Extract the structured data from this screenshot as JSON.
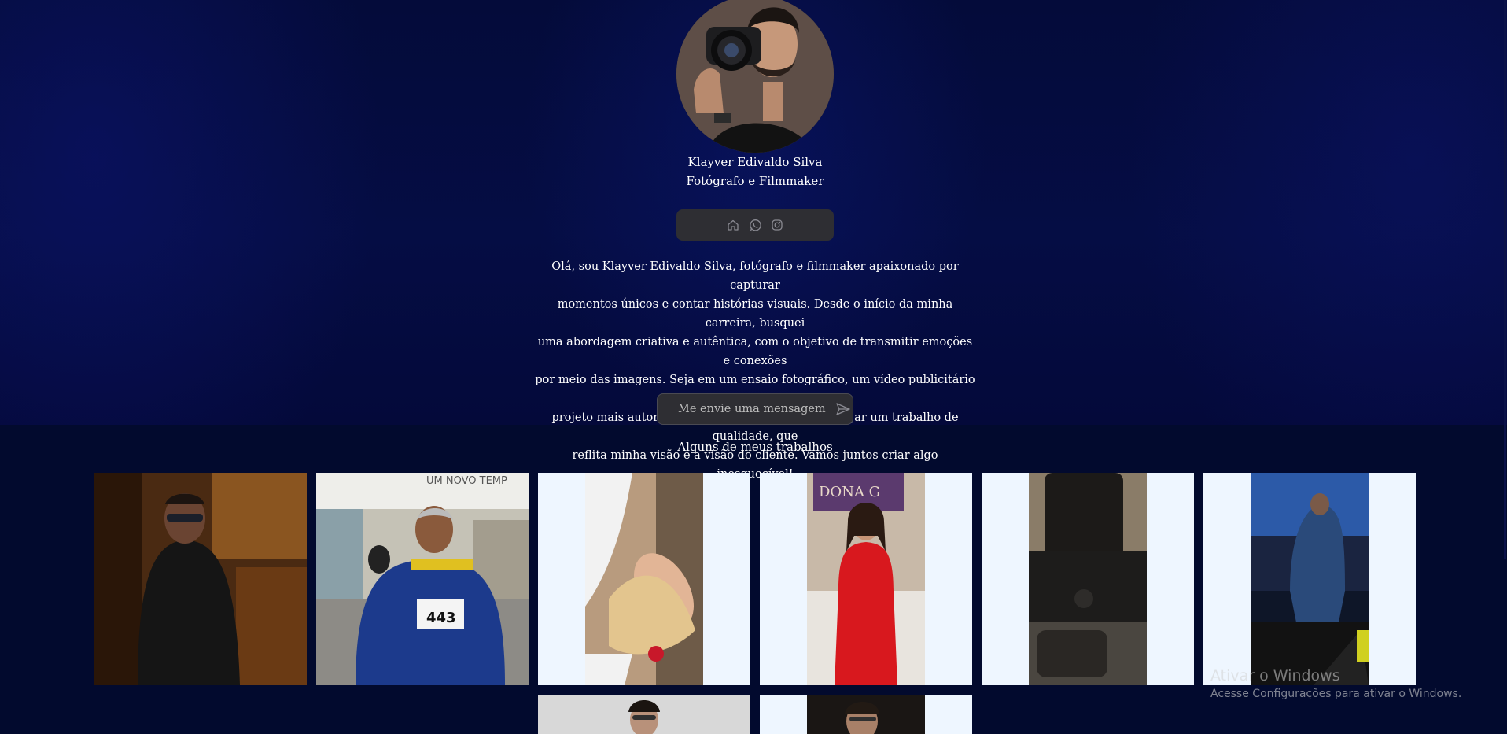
{
  "profile": {
    "name": "Klayver Edivaldo Silva",
    "role": "Fotógrafo e Filmmaker"
  },
  "social_icons": [
    "home-icon",
    "whatsapp-icon",
    "instagram-icon"
  ],
  "bio": [
    "Olá, sou Klayver Edivaldo Silva, fotógrafo e filmmaker apaixonado por capturar",
    "momentos únicos e contar histórias visuais. Desde o início da minha carreira, busquei",
    "uma abordagem criativa e autêntica, com o objetivo de transmitir emoções e conexões",
    "por meio das imagens. Seja em um ensaio fotográfico, um vídeo publicitário ou um",
    "projeto mais autoral, minha missão é sempre entregar um trabalho de qualidade, que",
    "reflita minha visão e a visão do cliente. Vamos juntos criar algo inesquecível!"
  ],
  "message": {
    "placeholder": "Me envie uma mensagem...",
    "value": ""
  },
  "gallery": {
    "title": "Alguns de meus trabalhos",
    "photo_texts": {
      "event_banner": "UM NOVO TEMP",
      "race_bib": "443",
      "store_sign": "DONA G"
    }
  },
  "watermark": {
    "line1": "Ativar o Windows",
    "line2": "Acesse Configurações para ativar o Windows."
  },
  "colors": {
    "background_top": "#050d44",
    "background_bottom": "#020a2e",
    "panel": "#2e2e33",
    "tile_background": "#eef6ff"
  }
}
